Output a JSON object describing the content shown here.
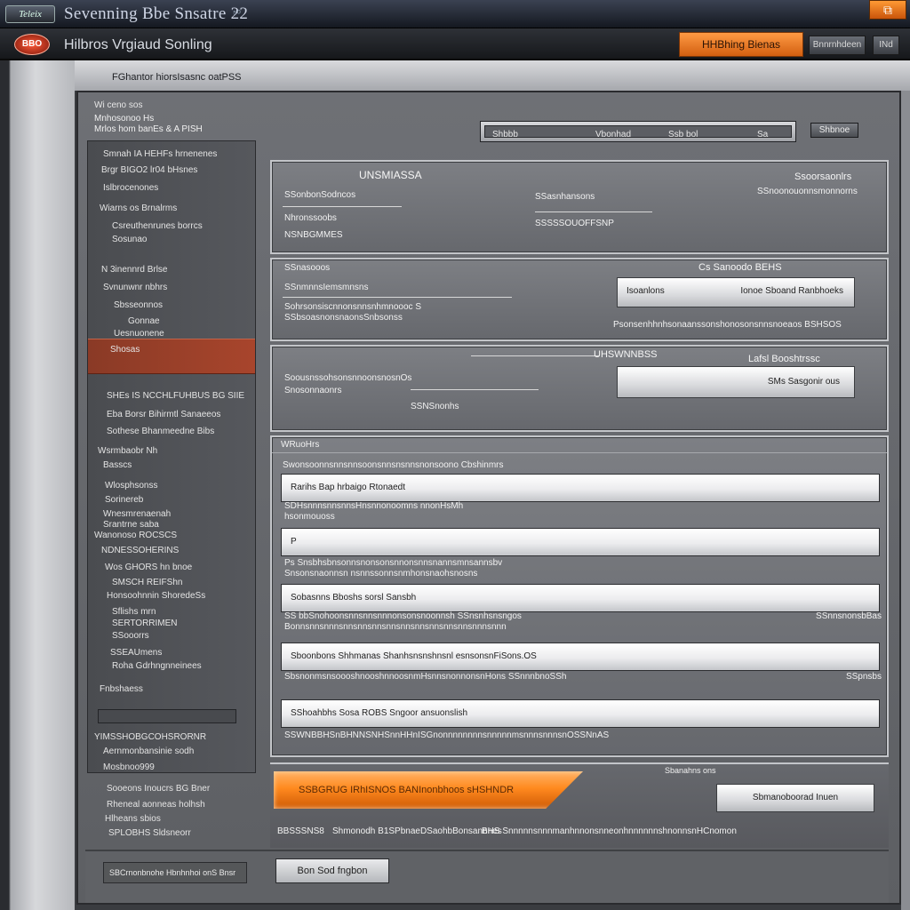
{
  "window": {
    "badge": "Teleix",
    "title": "Sevenning Bbe Snsatre 22",
    "title_mark": "⁵⁰",
    "close_icon": "⧉"
  },
  "header": {
    "logo_text": "BBO",
    "app_title": "Hilbros Vrgiaud Sonling",
    "primary_button": "HHBhing Bienas",
    "button2": "Bnnrnhdeen",
    "button3": "INd",
    "accent_color": "#ff8a1f"
  },
  "breadcrumb": "FGhantor hiorsIsasnc oatPSS",
  "sidebar": {
    "header1": "Wi ceno sos",
    "header2": "Mnhosonoo Hs",
    "header3": "Mrlos hom banEs & A PISH",
    "items": [
      "Smnah IA HEHFs hrnenenes",
      "Brgr BIGO2 lr04 bHsnes",
      "Islbrocenones",
      "Wiarns os Brnalrms",
      "Csreuthenrunes borrcs",
      "Sosunao",
      "N 3inennrd Brlse",
      "Svnunwnr nbhrs",
      "Sbsseonnos",
      "Gonnae",
      "Uesnuonene",
      "Shosas",
      "SHEs IS NCCHLFUHBUS BG SIIE",
      "Eba Borsr Bihirmtl Sanaeeos",
      "Sothese Bhanmeedne Bibs",
      "Wsrmbaobr Nh",
      "Basscs",
      "Wlosphsonss",
      "Sorinereb",
      "Wnesmrenaenah",
      "Srantrne saba",
      "Wanonoso ROCSCS",
      "NDNESSOHERINS",
      "Wos GHORS hn bnoe",
      "SMSCH REIFShn",
      "Honsoohnnin ShoredeSs",
      "Sflishs mrn",
      "SERTORRIMEN",
      "SSooorrs",
      "SSEAUmens",
      "Roha Gdrhngnneinees",
      "Fnbshaess"
    ],
    "below": [
      "YIMSSHOBGCOHSRORNR",
      "Aernmonbansinie sodh",
      "Mosbnoo999",
      "Sooeons Inoucrs BG Bner",
      "Rheneal aonneas holhsh",
      "Hlheans sbios",
      "SPLOBHS Sldsneorr"
    ]
  },
  "search": {
    "seg1": "Shbbb",
    "seg2": "Vbonhad",
    "seg3": "Ssb bol",
    "seg4": "Sa",
    "button": "Shbnoe"
  },
  "panel1": {
    "title": "UNSMIASSA",
    "right_title": "Ssoorsaonlrs",
    "right_sub": "SSnoonouonnsmonnorns",
    "field1_label": "SSonbonSodncos",
    "field2_label": "Nhronssoobs",
    "field3_label": "SSasnhansons",
    "field4_label": "NSNBGMMES",
    "field5_label": "SSSSSOUOFFSNP"
  },
  "panel2": {
    "title": "SSnasooos",
    "right_title": "Cs Sanoodo BEHS",
    "line1": "SSnmnnsIemsmnsns",
    "line2": "Sohrsonsiscnnonsnnsnhmnoooc S",
    "line3": "SSbsoasnonsnaonsSnbsonss",
    "button_left": "Isoanlons",
    "button_right": "Ionoe Sboand Ranbhoeks",
    "footnote": "Psonsenhhnhsonaanssonshonosonsnnsnoeaos BSHSOS"
  },
  "panel3": {
    "title": "UHSWNNBSS",
    "right_title": "Lafsl Booshtrssc",
    "line1": "SoousnssohsonsnnoonsnosnOs",
    "line2": "Snosonnaonrs",
    "line3": "SSNSnonhs",
    "button": "SMs Sasgonir ous"
  },
  "form": {
    "section_title": "WRuoHrs",
    "subtitle": "Swonsoonnsnnsnnsoonsnnsnsnnsnonsoono Cbshinmrs",
    "fields": [
      {
        "caption": "SDHsnnnsnnsnnsHnsnnonoomns nnonHsMh",
        "caption2": "hsonmouoss",
        "value": "Rarihs Bap hrbaigo Rtonaedt"
      },
      {
        "caption": "Ps Snsbhsbnsonnsnonsonsnnonsnnsnannsmnsannsbv",
        "caption2": "Snsonsnaonnsn nsnnssonnsnmhonsnaohsnosns",
        "value": "P"
      },
      {
        "caption": "SS bbSnohoonsnnsnnsnnnonsonsnoonnsh SSnsnhsnsngos",
        "caption2": "Bonnsnnsnnnsnnsnnsnnsnnsnnsnnsnnsnnsnnsnnnsnnn",
        "right": "SSnnsnonsbBas",
        "value": "Sobasnns  Bboshs sorsl Sansbh"
      },
      {
        "caption": "SbsnonmsnsoooshnooshnnoosnmHsnnsnonnonsnHons SSnnnbnoSSh",
        "caption2": "",
        "right": "SSpnsbs",
        "value": "Sboonbons  Shhmanas  Shanhsnsnshnsnl  esnsonsnFiSons.OS"
      },
      {
        "caption": "SSWNBBHSnBHNNSNHSnnHHnISGnonnnnnnnnsnnnnnmsnnnsnnnsnOSSNnAS",
        "caption2": "",
        "value": "SShoahbhs Sosa ROBS  Sngoor ansuonslish"
      }
    ]
  },
  "bottom": {
    "top_label": "Sbanahns ons",
    "progress_value": 100,
    "progress_label": "SSBGRUG IRhISNOS BANInonbhoos sHSHNDR",
    "finish_button": "Sbmanoboorad Inuen",
    "status1": "BBSSSNS8",
    "status2": "Shmonodh B1SPbnaeDSaohbBonsannnes",
    "status3": "BHS SnnnnnsnnnmanhnnonsnneonhnnnnnnshnonnsnHCnomon"
  },
  "footer": {
    "field_value": "SBCrnonbnohe Hbnhnhoi onS Bnsr",
    "button": "Bon Sod fngbon"
  }
}
